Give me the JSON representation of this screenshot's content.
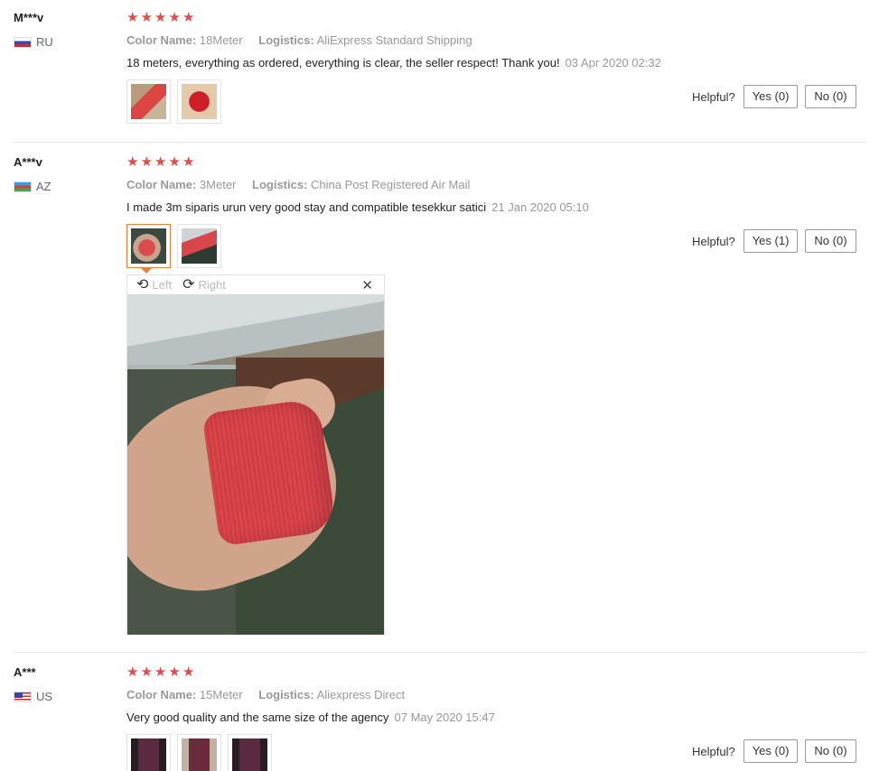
{
  "reviews": [
    {
      "user": "M***v",
      "country": "RU",
      "flag": "flag-ru",
      "stars": [
        "★",
        "★",
        "★",
        "★",
        "★"
      ],
      "color_label": "Color Name:",
      "color_value": "18Meter",
      "logistics_label": "Logistics:",
      "logistics_value": "AliExpress Standard Shipping",
      "text": "18 meters, everything as ordered, everything is clear, the seller respect! Thank you!",
      "date": "03 Apr 2020 02:32",
      "helpful_label": "Helpful?",
      "yes_label": "Yes (0)",
      "no_label": "No (0)"
    },
    {
      "user": "A***v",
      "country": "AZ",
      "flag": "flag-az",
      "stars": [
        "★",
        "★",
        "★",
        "★",
        "★"
      ],
      "color_label": "Color Name:",
      "color_value": "3Meter",
      "logistics_label": "Logistics:",
      "logistics_value": "China Post Registered Air Mail",
      "text": "I made 3m siparis urun very good stay and compatible tesekkur satici",
      "date": "21 Jan 2020 05:10",
      "helpful_label": "Helpful?",
      "yes_label": "Yes (1)",
      "no_label": "No (0)"
    },
    {
      "user": "A***",
      "country": "US",
      "flag": "flag-us",
      "stars": [
        "★",
        "★",
        "★",
        "★",
        "★"
      ],
      "color_label": "Color Name:",
      "color_value": "15Meter",
      "logistics_label": "Logistics:",
      "logistics_value": "Aliexpress Direct",
      "text": "Very good quality and the same size of the agency",
      "date": "07 May 2020 15:47",
      "helpful_label": "Helpful?",
      "yes_label": "Yes (0)",
      "no_label": "No (0)"
    }
  ],
  "viewer": {
    "rotate_left_icon": "rotate-left-icon",
    "rotate_left_label": "Left",
    "rotate_right_icon": "rotate-right-icon",
    "rotate_right_label": "Right",
    "close_icon": "close-icon",
    "close_glyph": "✕"
  },
  "colors": {
    "star": "#e34b4b",
    "active_thumb_border": "#e0823a",
    "meta_text": "#999999",
    "separator": "#e6e6e6"
  }
}
